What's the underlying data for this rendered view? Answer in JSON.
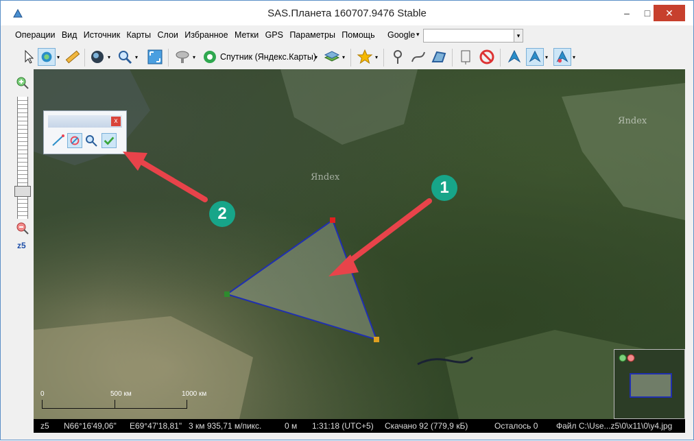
{
  "window": {
    "title": "SAS.Планета 160707.9476 Stable",
    "min": "–",
    "max": "□",
    "close": "✕"
  },
  "menu": [
    "Операции",
    "Вид",
    "Источник",
    "Карты",
    "Слои",
    "Избранное",
    "Метки",
    "GPS",
    "Параметры",
    "Помощь"
  ],
  "search": {
    "engine": "Google",
    "arrow": "▾",
    "value": ""
  },
  "toolbar": {
    "map_source": "Спутник (Яндекс.Карты)",
    "icons": [
      "cursor-icon",
      "move-icon",
      "ruler-icon",
      "globe-icon",
      "magnifier-icon",
      "fullscreen-icon",
      "satellite-dish-icon",
      "map-source-icon",
      "layers-icon",
      "favorite-star-icon",
      "placemark-icon",
      "path-icon",
      "polygon-icon",
      "marks-icon",
      "no-marks-icon",
      "gps-icon",
      "gps-track-icon",
      "gps-center-icon"
    ]
  },
  "zoom": {
    "level": "z5"
  },
  "map": {
    "watermarks": [
      "Яndex",
      "Яndex"
    ],
    "scale_labels": [
      "0",
      "500 км",
      "1000 км"
    ]
  },
  "float_panel": {
    "close": "x",
    "tools": [
      "add-path-icon",
      "select-area-icon",
      "zoom-area-icon",
      "apply-check-icon"
    ]
  },
  "callouts": [
    "1",
    "2"
  ],
  "status": {
    "zoom": "z5",
    "lat": "N66°16'49,06\"",
    "lon": "E69°47'18,81\"",
    "resolution": "3 км 935,71 м/пикс.",
    "distance": "0 м",
    "time": "1:31:18 (UTC+5)",
    "downloaded": "Скачано 92 (779,9 кБ)",
    "remaining": "Осталось 0",
    "file": "Файл C:\\Use...z5\\0\\x11\\0\\y4.jpg"
  },
  "colors": {
    "accent": "#17a589",
    "polygon_stroke": "#1f2fb0",
    "arrow": "#e8434a",
    "close_button": "#c7402d"
  }
}
